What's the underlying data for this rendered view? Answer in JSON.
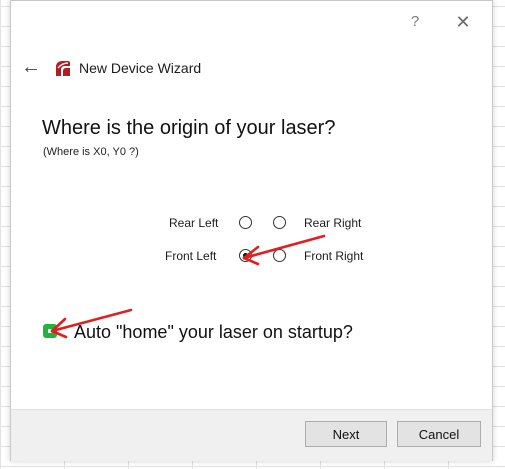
{
  "window": {
    "help_glyph": "?",
    "close_glyph": "✕"
  },
  "header": {
    "back_glyph": "←",
    "title": "New Device Wizard",
    "app_icon": "lightburn-logo-icon",
    "app_icon_color": "#b01e23"
  },
  "content": {
    "question": "Where is the origin of your laser?",
    "subquestion": "(Where is X0, Y0 ?)",
    "origin_options": {
      "rear_left": "Rear Left",
      "rear_right": "Rear Right",
      "front_left": "Front Left",
      "front_right": "Front Right",
      "selected": "Front Left"
    },
    "auto_home": {
      "label": "Auto \"home\" your laser on startup?",
      "checked": true,
      "toggle_color": "#24b33a"
    }
  },
  "footer": {
    "next_label": "Next",
    "cancel_label": "Cancel"
  },
  "annotations": {
    "arrow_color": "#e02020",
    "arrow_icon": "red-arrow-icon"
  }
}
